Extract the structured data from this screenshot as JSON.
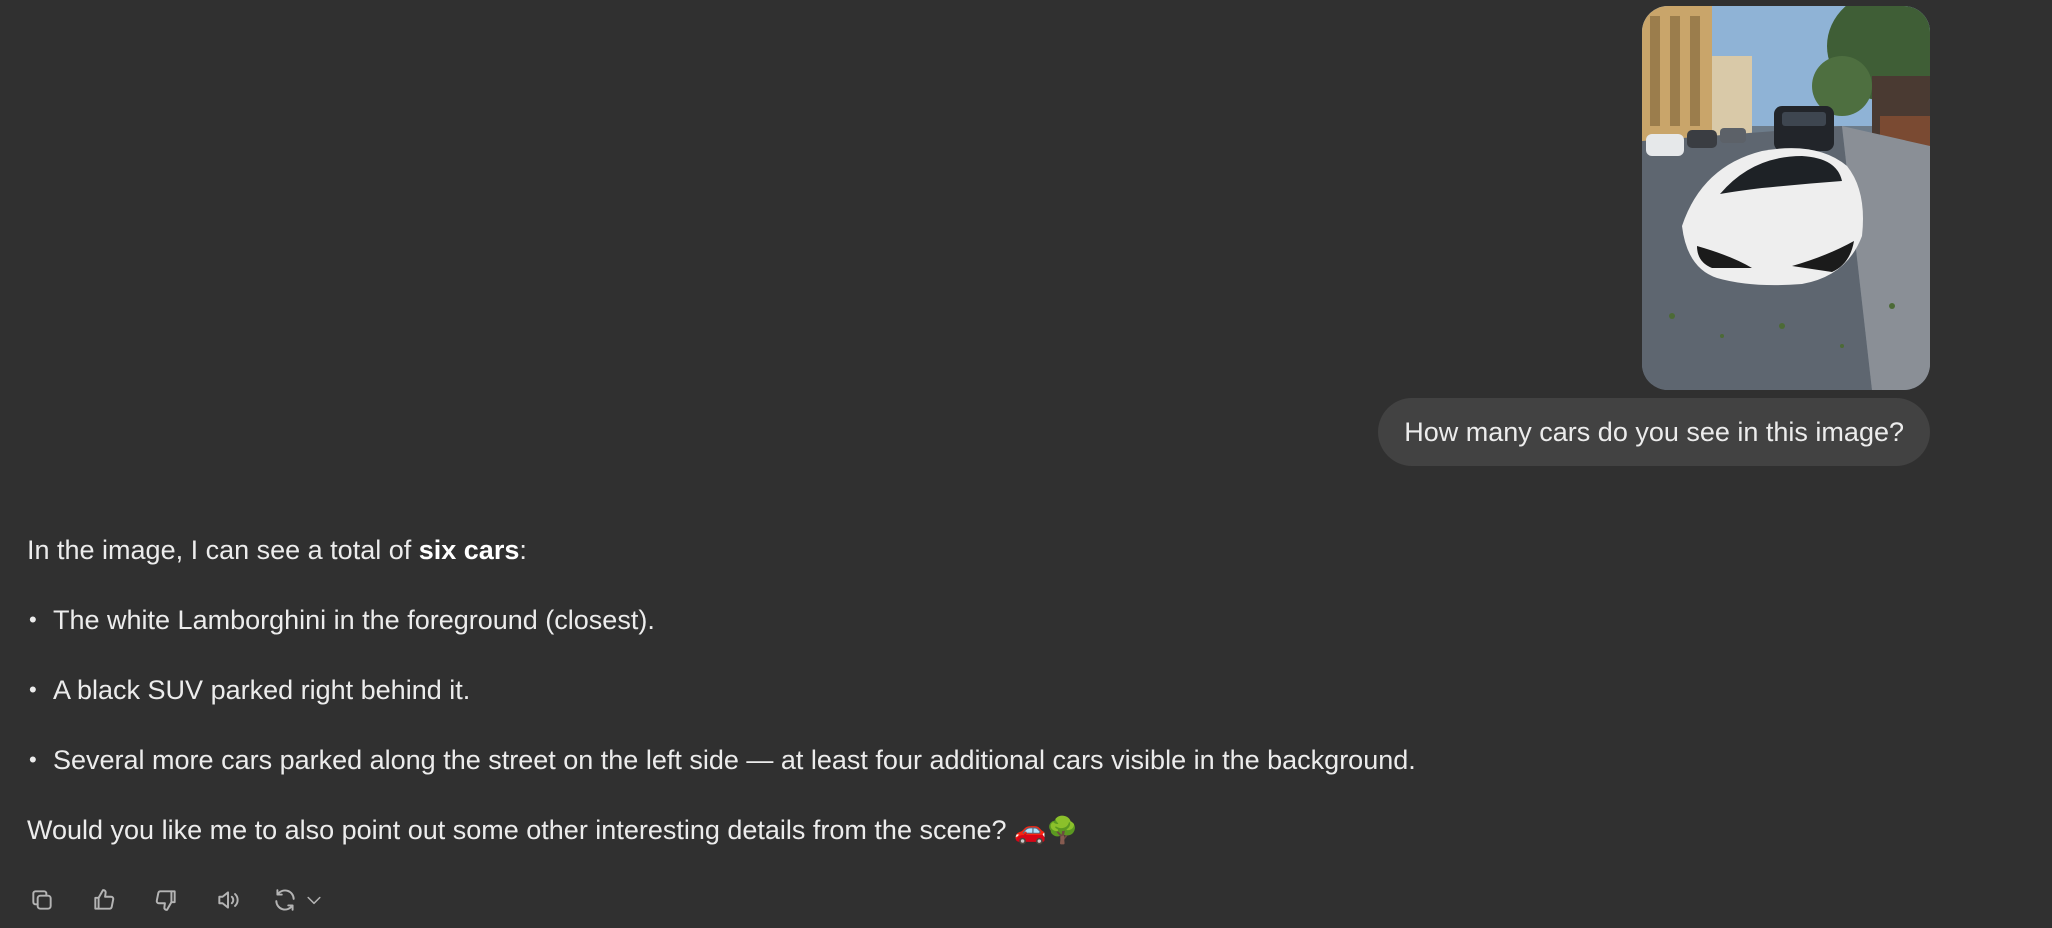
{
  "user_message": {
    "image_alt": "Photo of a white Lamborghini parked on a city street",
    "text": "How many cars do you see in this image?"
  },
  "assistant_message": {
    "intro_prefix": "In the image, I can see a total of ",
    "intro_bold": "six cars",
    "intro_suffix": ":",
    "bullets": [
      "The white Lamborghini in the foreground (closest).",
      "A black SUV parked right behind it.",
      "Several more cars parked along the street on the left side — at least four additional cars visible in the background."
    ],
    "closing_text": "Would you like me to also point out some other interesting details from the scene?",
    "closing_emoji": "🚗🌳"
  },
  "toolbar": {
    "icons": [
      "copy-icon",
      "thumbs-up-icon",
      "thumbs-down-icon",
      "read-aloud-icon",
      "regenerate-icon",
      "chevron-down-icon"
    ]
  },
  "colors": {
    "background": "#303030",
    "user_bubble": "#424242",
    "text": "#ececec",
    "icon": "#b4b4b4"
  }
}
